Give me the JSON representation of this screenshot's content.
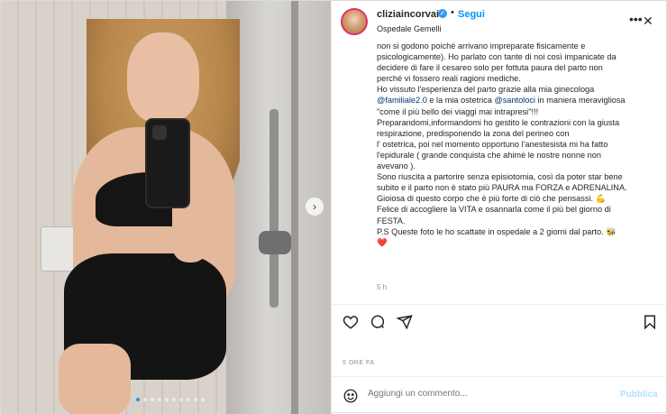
{
  "post": {
    "username": "cliziaincorvaia",
    "separator": "•",
    "follow_label": "Segui",
    "location": "Ospedale Gemelli",
    "more_label": "•••",
    "close_label": "✕",
    "next_label": "›",
    "caption_lines": [
      "non si godono poiché arrivano impreparate fisicamente e",
      "psicologicamente). Ho parlato con tante di noi così impanicate da",
      "decidere di fare il cesareo solo per fottuta paura del parto non",
      "perché vi fossero reali ragioni mediche.",
      "Ho vissuto l'esperienza del parto grazie alla mia ginecologa"
    ],
    "mention_line": {
      "mention1": "@familiale2.0",
      "mid": " e la mia ostetrica ",
      "mention2": "@santoloci",
      "tail": " in maniera meravigliosa"
    },
    "caption_lines2": [
      "\"come il più bello dei viaggi mai intrapresi\"!!!",
      "Preparandomi,informandomi ho gestito le contrazioni con la giusta",
      "respirazione, predisponendo la zona del perineo con",
      "l' ostetrica, poi nel momento opportuno l'anestesista mi ha fatto",
      "l'epidurale ( grande conquista che ahimè le nostre nonne non",
      "avevano ).",
      "Sono riuscita a partorire senza episiotomia, così da poter star bene",
      "subito e il parto non è stato più PAURA ma FORZA e ADRENALINA.",
      "Gioiosa di questo corpo che è più forte di ciò che pensassi. 💪",
      "Felice di accogliere la VITA e osannarla come il più bel giorno di",
      "FESTA.",
      "P.S Queste foto le ho scattate in ospedale a 2 giorni dal parto. 🐝",
      "❤️"
    ],
    "caption_time": "5 h",
    "posted": "5 ORE FA",
    "comment_placeholder": "Aggiungi un commento...",
    "publish_label": "Pubblica",
    "icons": {
      "like": "heart-icon",
      "comment": "comment-icon",
      "share": "share-icon",
      "save": "bookmark-icon",
      "emoji": "emoji-icon"
    },
    "carousel": {
      "count": 10,
      "active": 0
    }
  }
}
